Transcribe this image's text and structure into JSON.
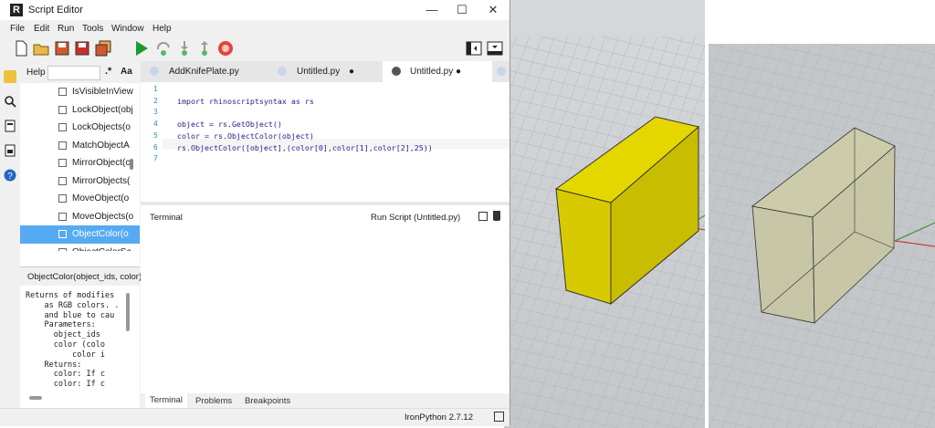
{
  "window": {
    "title": "Script Editor",
    "app_icon": "rhino-logo-icon",
    "controls": {
      "minimize": "—",
      "maximize": "☐",
      "close": "✕"
    }
  },
  "menu": [
    "File",
    "Edit",
    "Run",
    "Tools",
    "Window",
    "Help"
  ],
  "toolbar": {
    "icons": [
      "new-file-icon",
      "open-folder-icon",
      "save-icon",
      "save-as-icon",
      "save-all-icon",
      "run-icon",
      "step-over-icon",
      "step-into-icon",
      "step-out-icon",
      "stop-icon"
    ],
    "right_icons": [
      "toggle-left-panel-icon",
      "toggle-bottom-panel-icon"
    ]
  },
  "activity_bar": [
    "folder-icon",
    "search-icon",
    "document-icon",
    "python-file-icon",
    "help-icon"
  ],
  "help": {
    "label": "Help",
    "search_value": "",
    "regex_label": ".*",
    "case_label": "Aa",
    "items": [
      {
        "label": "IsVisibleInView",
        "selected": false
      },
      {
        "label": "LockObject(obj",
        "selected": false
      },
      {
        "label": "LockObjects(o",
        "selected": false
      },
      {
        "label": "MatchObjectA",
        "selected": false
      },
      {
        "label": "MirrorObject(c",
        "selected": false
      },
      {
        "label": "MirrorObjects(",
        "selected": false
      },
      {
        "label": "MoveObject(o",
        "selected": false
      },
      {
        "label": "MoveObjects(o",
        "selected": false
      },
      {
        "label": "ObjectColor(o",
        "selected": true
      },
      {
        "label": "ObjectColorSc",
        "selected": false
      }
    ],
    "signature": "ObjectColor(object_ids, color)",
    "doc_lines": [
      "Returns of modifies",
      "    as RGB colors. .",
      "    and blue to cau",
      "    Parameters:",
      "      object_ids",
      "      color (colo",
      "          color i",
      "    Returns:",
      "      color: If c",
      "      color: If c"
    ]
  },
  "tabs": [
    {
      "name": "AddKnifePlate.py",
      "modified": false,
      "active": false
    },
    {
      "name": "Untitled.py",
      "modified": true,
      "active": false
    },
    {
      "name": "Untitled.py",
      "modified": true,
      "active": true
    }
  ],
  "modified_marker": "●",
  "code": {
    "line_numbers": [
      "1",
      "2",
      "3",
      "4",
      "5",
      "6",
      "7"
    ],
    "lines": [
      "",
      "import rhinoscriptsyntax as rs",
      "",
      "object = rs.GetObject()",
      "color = rs.ObjectColor(object)",
      "rs.ObjectColor([object],(color[0],color[1],color[2],25))",
      ""
    ]
  },
  "terminal": {
    "title": "Terminal",
    "run_label": "Run Script (Untitled.py)",
    "copy_icon": "copy-icon",
    "clear_icon": "trash-icon"
  },
  "bottom_tabs": [
    "Terminal",
    "Problems",
    "Breakpoints"
  ],
  "status": {
    "interpreter": "IronPython 2.7.12",
    "icon": "panel-icon"
  },
  "colors": {
    "box_yellow": "#e0d400",
    "box_transparent": "#c3c193",
    "selection": "#56aaf2",
    "run_green": "#1c9a2c",
    "stop_red": "#e2453c"
  }
}
